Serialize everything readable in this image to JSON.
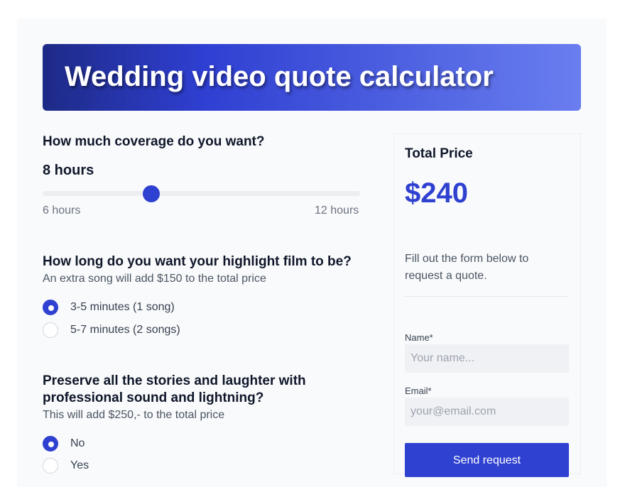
{
  "header": {
    "title": "Wedding video quote calculator"
  },
  "coverage": {
    "question": "How much coverage do you want?",
    "value_label": "8 hours",
    "min_label": "6 hours",
    "max_label": "12 hours",
    "slider_value": 8,
    "slider_min": 6,
    "slider_max": 12
  },
  "highlight": {
    "question": "How long do you want your highlight film to be?",
    "subtitle": "An extra song will add $150 to the total price",
    "options": [
      {
        "label": "3-5 minutes (1 song)",
        "checked": true
      },
      {
        "label": "5-7 minutes (2 songs)",
        "checked": false
      }
    ]
  },
  "sound": {
    "question_line1": "Preserve all the stories and laughter with",
    "question_line2": "professional sound and lightning?",
    "subtitle": "This will add $250,- to the total price",
    "options": [
      {
        "label": "No",
        "checked": true
      },
      {
        "label": "Yes",
        "checked": false
      }
    ]
  },
  "sidebar": {
    "total_label": "Total Price",
    "total_price": "$240",
    "note": "Fill out the form below to request a quote.",
    "name_label": "Name*",
    "name_placeholder": "Your name...",
    "email_label": "Email*",
    "email_placeholder": "your@email.com",
    "send_label": "Send request"
  },
  "colors": {
    "accent": "#2f41d0",
    "banner_start": "#1e2a86",
    "banner_end": "#6a7ef0"
  }
}
